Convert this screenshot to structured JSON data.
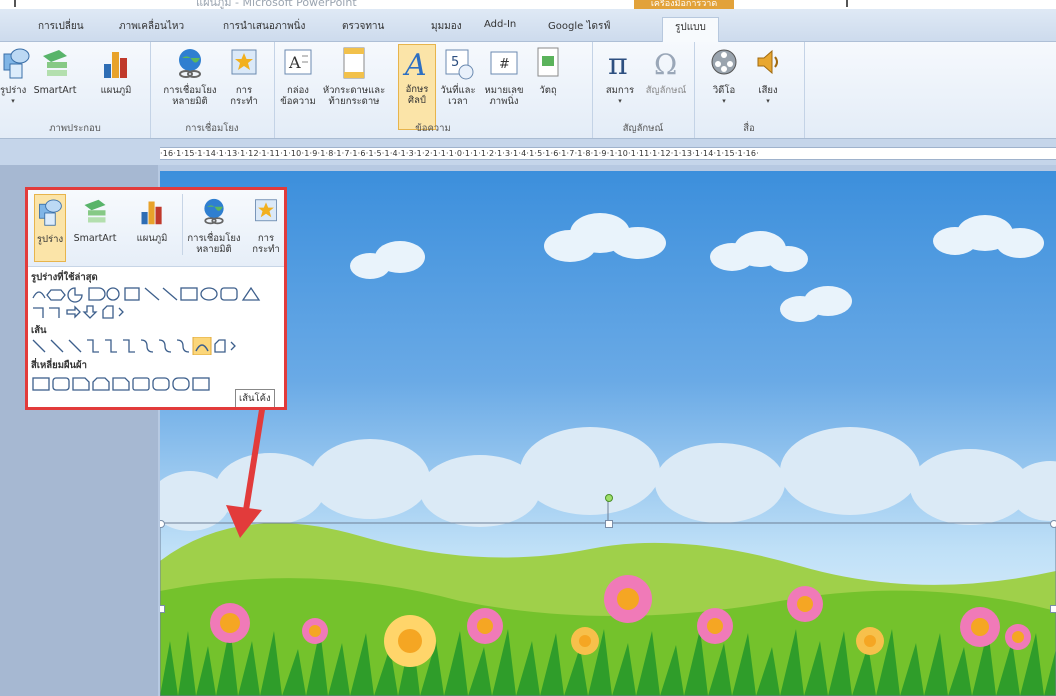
{
  "titlebar": {
    "title": "แผนภูมิ - Microsoft PowerPoint",
    "contextual_tab": "เครื่องมือการวาด"
  },
  "tabs": [
    "การเปลี่ยน",
    "ภาพเคลื่อนไหว",
    "การนำเสนอภาพนิ่ง",
    "ตรวจทาน",
    "มุมมอง",
    "Add-In",
    "Google ไดรฟ์",
    "รูปแบบ"
  ],
  "ribbon": {
    "groups": [
      {
        "label": "ภาพประกอบ",
        "buttons": [
          "รูปร่าง",
          "SmartArt",
          "แผนภูมิ"
        ]
      },
      {
        "label": "การเชื่อมโยง",
        "buttons": [
          "การเชื่อมโยง\nหลายมิติ",
          "การ\nกระทำ"
        ]
      },
      {
        "label": "ข้อความ",
        "buttons": [
          "กล่อง\nข้อความ",
          "หัวกระดาษและ\nท้ายกระดาษ",
          "อักษร\nศิลป์",
          "วันที่และ\nเวลา",
          "หมายเลข\nภาพนิ่ง",
          "วัตถุ"
        ]
      },
      {
        "label": "สัญลักษณ์",
        "buttons": [
          "สมการ",
          "สัญลักษณ์"
        ]
      },
      {
        "label": "สื่อ",
        "buttons": [
          "วิดีโอ",
          "เสียง"
        ]
      }
    ]
  },
  "ruler": {
    "text": "·16·1·15·1·14·1·13·1·12·1·11·1·10·1·9·1·8·1·7·1·6·1·5·1·4·1·3·1·2·1·1·1·0·1·1·1·2·1·3·1·4·1·5·1·6·1·7·1·8·1·9·1·10·1·11·1·12·1·13·1·14·1·15·1·16·"
  },
  "popup": {
    "buttons": [
      "รูปร่าง",
      "SmartArt",
      "แผนภูมิ",
      "การเชื่อมโยง\nหลายมิติ",
      "การ\nกระทำ"
    ],
    "recent_shapes_title": "รูปร่างที่ใช้ล่าสุด",
    "lines_title": "เส้น",
    "rectangles_title": "สี่เหลี่ยมผืนผ้า",
    "tooltip": "เส้นโค้ง"
  },
  "colors": {
    "annotation_red": "#e23b3b",
    "sky_top": "#3c8fdc",
    "grass": "#74c22c"
  }
}
